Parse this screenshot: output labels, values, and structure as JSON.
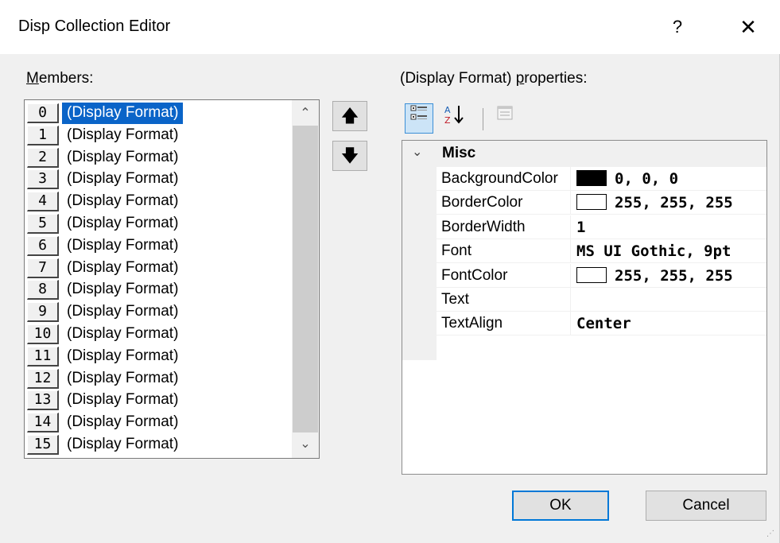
{
  "window": {
    "title": "Disp Collection Editor",
    "help_glyph": "?",
    "close_glyph": "✕"
  },
  "members": {
    "label_accel": "M",
    "label_rest": "embers:",
    "selected_index": 0,
    "items": [
      {
        "index": "0",
        "label": "(Display Format)"
      },
      {
        "index": "1",
        "label": "(Display Format)"
      },
      {
        "index": "2",
        "label": "(Display Format)"
      },
      {
        "index": "3",
        "label": "(Display Format)"
      },
      {
        "index": "4",
        "label": "(Display Format)"
      },
      {
        "index": "5",
        "label": "(Display Format)"
      },
      {
        "index": "6",
        "label": "(Display Format)"
      },
      {
        "index": "7",
        "label": "(Display Format)"
      },
      {
        "index": "8",
        "label": "(Display Format)"
      },
      {
        "index": "9",
        "label": "(Display Format)"
      },
      {
        "index": "10",
        "label": "(Display Format)"
      },
      {
        "index": "11",
        "label": "(Display Format)"
      },
      {
        "index": "12",
        "label": "(Display Format)"
      },
      {
        "index": "13",
        "label": "(Display Format)"
      },
      {
        "index": "14",
        "label": "(Display Format)"
      },
      {
        "index": "15",
        "label": "(Display Format)"
      }
    ],
    "scroll_up_glyph": "⌃",
    "scroll_down_glyph": "⌄",
    "move_up_glyph": "🡅",
    "move_down_glyph": "🡇"
  },
  "properties": {
    "label_before": "(Display Format) ",
    "label_accel": "p",
    "label_after": "roperties:",
    "category": "Misc",
    "category_chevron": "⌄",
    "rows": [
      {
        "name": "BackgroundColor",
        "swatch": "#000000",
        "value": "0, 0, 0"
      },
      {
        "name": "BorderColor",
        "swatch": "#ffffff",
        "value": "255, 255, 255"
      },
      {
        "name": "BorderWidth",
        "swatch": null,
        "value": "1"
      },
      {
        "name": "Font",
        "swatch": null,
        "value": "MS UI Gothic, 9pt"
      },
      {
        "name": "FontColor",
        "swatch": "#ffffff",
        "value": "255, 255, 255"
      },
      {
        "name": "Text",
        "swatch": null,
        "value": ""
      },
      {
        "name": "TextAlign",
        "swatch": null,
        "value": "Center"
      }
    ]
  },
  "toolbar": {
    "categorized_icon": "categorized-icon",
    "alphabetical_icon": "alphabetical-sort-icon",
    "property_pages_icon": "property-pages-icon"
  },
  "buttons": {
    "ok": "OK",
    "cancel": "Cancel"
  },
  "colors": {
    "selection": "#0a64c8",
    "default_button_border": "#0078d7",
    "toolbar_active": "#cce4f7"
  }
}
